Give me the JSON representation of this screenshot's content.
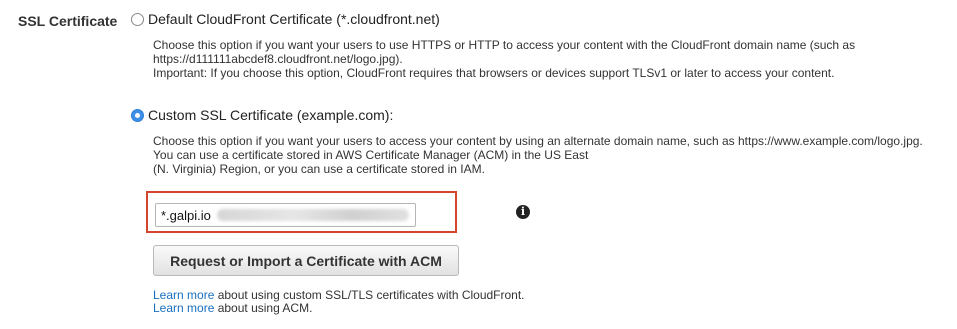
{
  "section_label": "SSL Certificate",
  "default_option": {
    "label": "Default CloudFront Certificate (*.cloudfront.net)",
    "selected": false,
    "desc_lines": [
      "Choose this option if you want your users to use HTTPS or HTTP to access your content with the CloudFront domain name (such as",
      "https://d111111abcdef8.cloudfront.net/logo.jpg).",
      "Important: If you choose this option, CloudFront requires that browsers or devices support TLSv1 or later to access your content."
    ]
  },
  "custom_option": {
    "label": "Custom SSL Certificate (example.com):",
    "selected": true,
    "desc_lines": [
      "Choose this option if you want your users to access your content by using an alternate domain name, such as https://www.example.com/logo.jpg.",
      "You can use a certificate stored in AWS Certificate Manager (ACM) in the US East",
      "(N. Virginia) Region, or you can use a certificate stored in IAM."
    ]
  },
  "certificate_field": {
    "value": "*.galpi.io"
  },
  "info_icon": "info-icon",
  "acm_button_label": "Request or Import a Certificate with ACM",
  "learn_more": [
    {
      "link": "Learn more",
      "text": " about using custom SSL/TLS certificates with CloudFront."
    },
    {
      "link": "Learn more",
      "text": " about using ACM."
    }
  ],
  "colors": {
    "highlight": "#d5452b",
    "link": "#1a6fbf",
    "radio_selected": "#3d8ee6"
  }
}
